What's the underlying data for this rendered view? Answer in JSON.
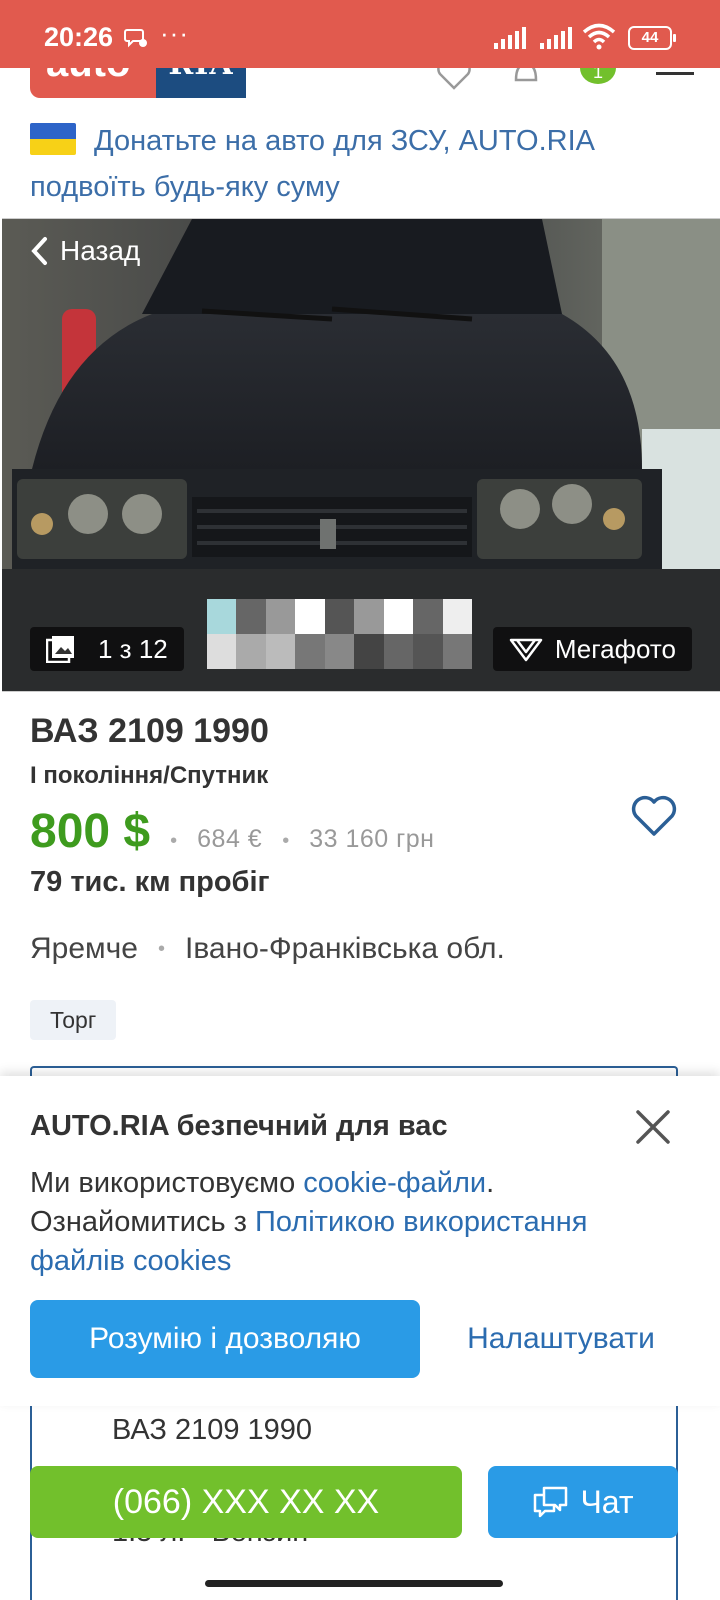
{
  "status_bar": {
    "time": "20:26",
    "dots": "···",
    "battery": "44"
  },
  "header": {
    "logo_auto": "auto",
    "logo_ria": "RIA",
    "badge_count": "1"
  },
  "donate": {
    "text": "Донатьте на авто для ЗСУ, AUTO.RIA подвоїть будь-яку суму",
    "flag_colors": [
      "#2d64c8",
      "#f7d117"
    ]
  },
  "photo": {
    "back_label": "Назад",
    "counter": "1 з 12",
    "mega_label": "Мегафото"
  },
  "listing": {
    "title": "ВАЗ 2109 1990",
    "generation": "І покоління/Спутник",
    "price_usd": "800 $",
    "price_eur": "684  €",
    "price_uah": "33 160  грн",
    "mileage": "79 тис. км пробіг",
    "city": "Яремче",
    "region": "Івано-Франківська обл.",
    "bargain_tag": "Торг"
  },
  "cookie": {
    "title": "AUTO.RIA безпечний для вас",
    "text_1": "Ми використовуємо ",
    "link_1": "cookie-файли",
    "text_2": ". Ознайомитись з ",
    "link_2": "Політикою використання файлів cookies",
    "accept_label": "Розумію і дозволяю",
    "settings_label": "Налаштувати"
  },
  "below": {
    "title": "ВАЗ 2109 1990",
    "engine": "1.5 л. • Бензин"
  },
  "actions": {
    "phone_label": "(066) XXX XX XX",
    "chat_label": "Чат"
  },
  "colors": {
    "status_bar": "#e15a4e",
    "price_green": "#3e9b1e",
    "link_blue": "#2b6cb0",
    "button_blue": "#2a9be6",
    "button_green": "#72c02c"
  }
}
